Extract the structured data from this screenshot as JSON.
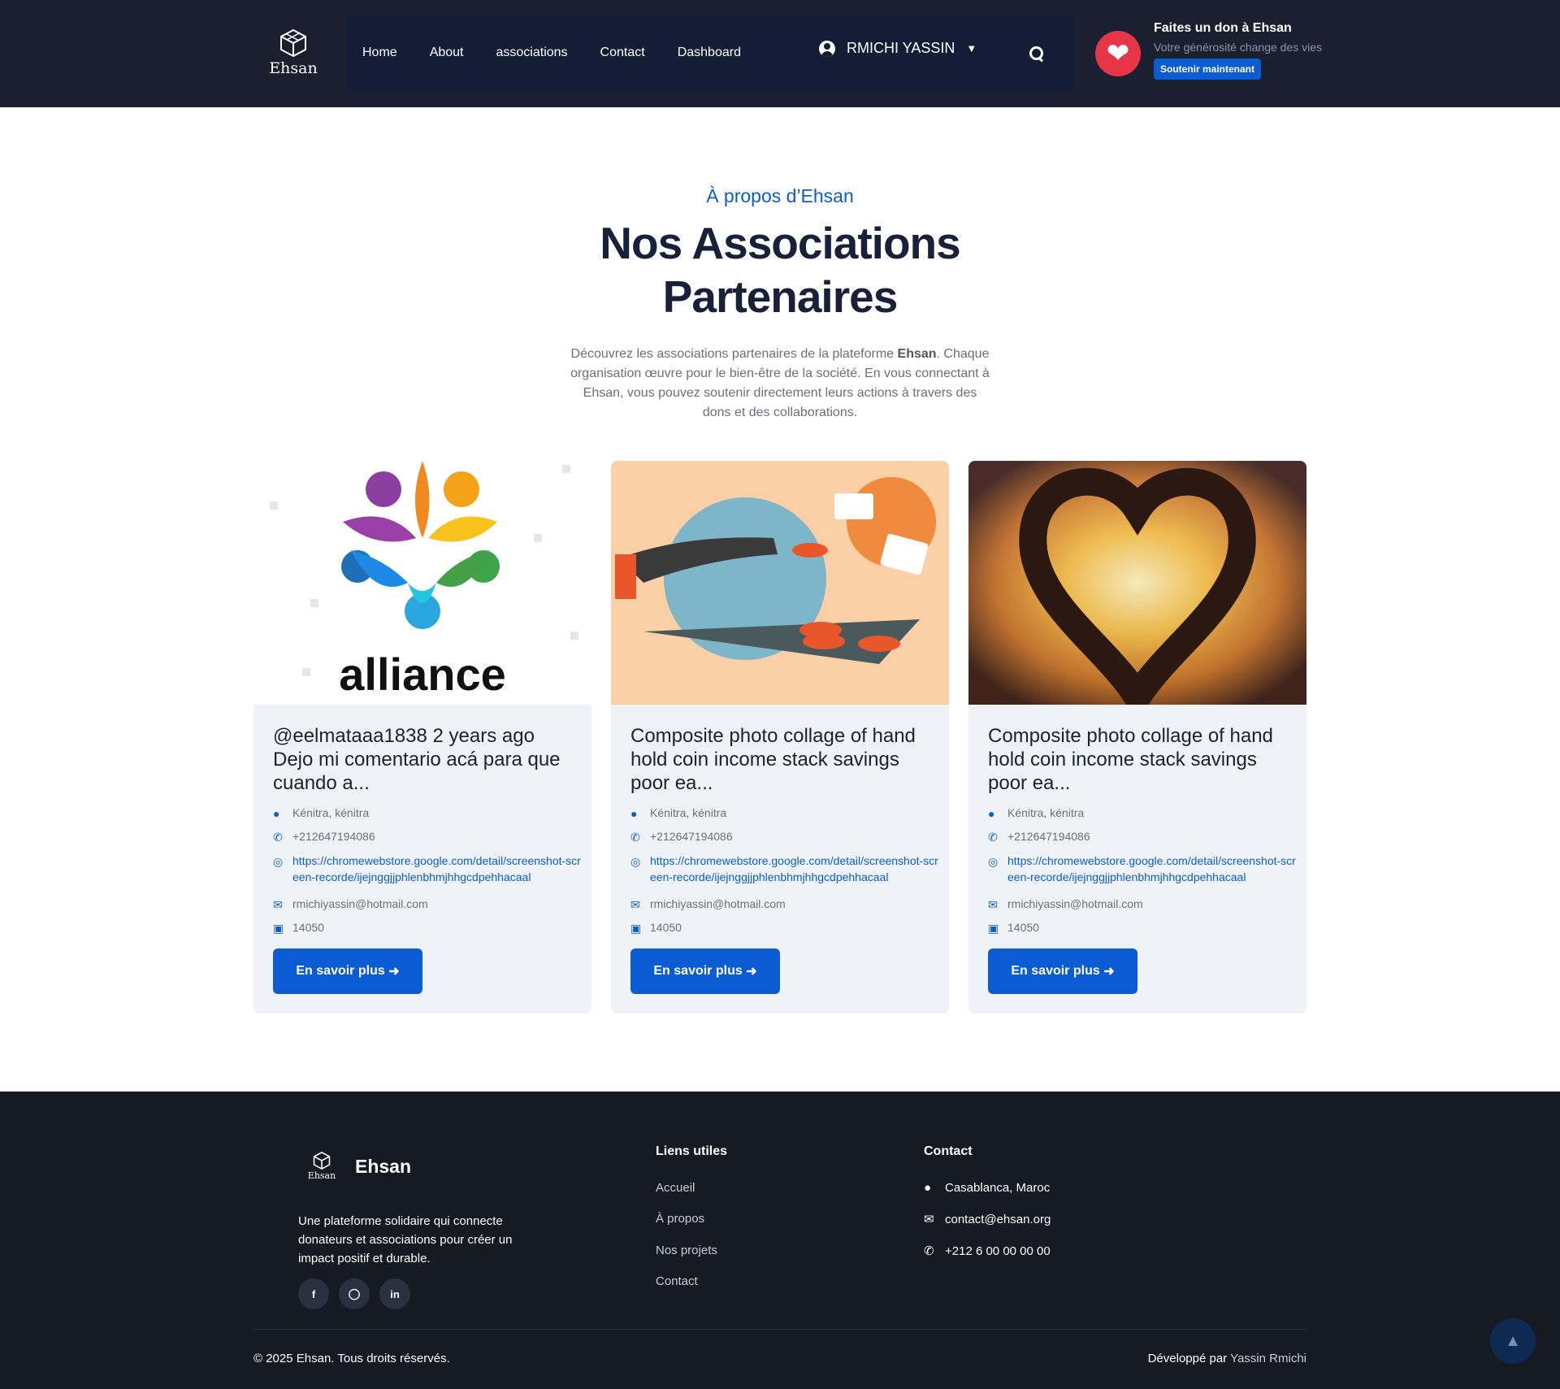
{
  "header": {
    "logo_text": "Ehsan",
    "nav": [
      "Home",
      "About",
      "associations",
      "Contact",
      "Dashboard"
    ],
    "user_name": "RMICHI YASSIN",
    "donate": {
      "title": "Faites un don à Ehsan",
      "subtitle": "Votre générosité change des vies",
      "button": "Soutenir maintenant"
    }
  },
  "intro": {
    "kicker": "À propos d’Ehsan",
    "title": "Nos Associations Partenaires",
    "desc_before": "Découvrez les associations partenaires de la plateforme ",
    "desc_brand": "Ehsan",
    "desc_after": ". Chaque organisation œuvre pour le bien-être de la société. En vous connectant à Ehsan, vous pouvez soutenir directement leurs actions à travers des dons et des collaborations."
  },
  "cards": [
    {
      "image": "alliance",
      "image_word": "alliance",
      "title": "@eelmataaa1838 2 years ago Dejo mi comentario acá para que cuando a...",
      "location": "Kénitra, kénitra",
      "phone": "+212647194086",
      "website": "https://chromewebstore.google.com/detail/screenshot-screen-recorde/ijejnggjjphlenbhmjhhgcdpehhacaal",
      "email": "rmichiyassin@hotmail.com",
      "code": "14050",
      "button": "En savoir plus"
    },
    {
      "image": "coin-collage",
      "title": "Composite photo collage of hand hold coin income stack savings poor ea...",
      "location": "Kénitra, kénitra",
      "phone": "+212647194086",
      "website": "https://chromewebstore.google.com/detail/screenshot-screen-recorde/ijejnggjjphlenbhmjhhgcdpehhacaal",
      "email": "rmichiyassin@hotmail.com",
      "code": "14050",
      "button": "En savoir plus"
    },
    {
      "image": "hands-heart-sunset",
      "title": "Composite photo collage of hand hold coin income stack savings poor ea...",
      "location": "Kénitra, kénitra",
      "phone": "+212647194086",
      "website": "https://chromewebstore.google.com/detail/screenshot-screen-recorde/ijejnggjjphlenbhmjhhgcdpehhacaal",
      "email": "rmichiyassin@hotmail.com",
      "code": "14050",
      "button": "En savoir plus"
    }
  ],
  "footer": {
    "logo_text": "Ehsan",
    "brand": "Ehsan",
    "about": "Une plateforme solidaire qui connecte donateurs et associations pour créer un impact positif et durable.",
    "social": [
      "facebook-icon",
      "instagram-icon",
      "linkedin-icon"
    ],
    "links_title": "Liens utiles",
    "links": [
      "Accueil",
      "À propos",
      "Nos projets",
      "Contact"
    ],
    "contact_title": "Contact",
    "contact": {
      "city": "Casablanca, Maroc",
      "email": "contact@ehsan.org",
      "phone": "+212 6 00 00 00 00"
    },
    "copyright": "© 2025 Ehsan. Tous droits réservés.",
    "dev_label": "Développé par",
    "dev_name": "Yassin Rmichi"
  },
  "colors": {
    "header_bg": "#1b2030",
    "nav_bg": "#141d36",
    "accent": "#0b5bd3",
    "donate_heart": "#e53546",
    "card_bg": "#eff3f8",
    "footer_bg": "#161a22"
  }
}
